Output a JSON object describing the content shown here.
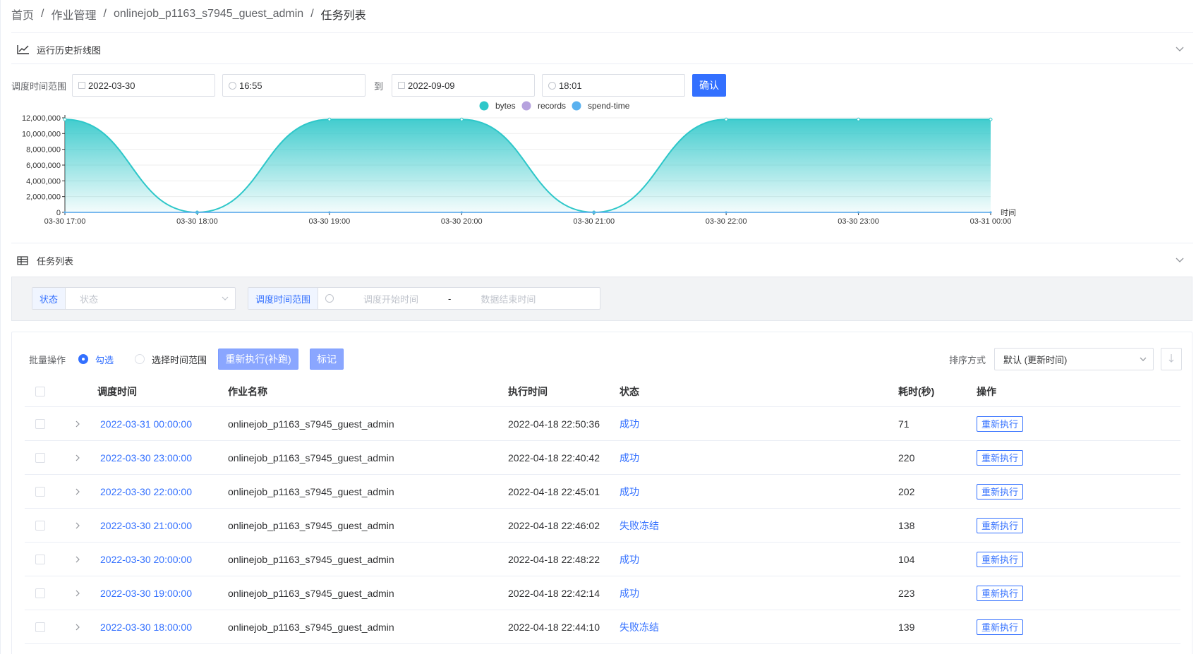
{
  "breadcrumb": [
    "首页",
    "作业管理",
    "onlinejob_p1163_s7945_guest_admin",
    "任务列表"
  ],
  "history_section": {
    "title": "运行历史折线图",
    "icon": "line-chart-icon",
    "collapse_icon": "chevron-down-icon"
  },
  "date_range": {
    "label": "调度时间范围",
    "start_date": "2022-03-30",
    "start_time": "16:55",
    "to_label": "到",
    "end_date": "2022-09-09",
    "end_time": "18:01",
    "confirm_label": "确认"
  },
  "chart_data": {
    "type": "area",
    "legend": [
      "bytes",
      "records",
      "spend-time"
    ],
    "legend_position": "top-center",
    "colors": {
      "bytes": "#2ec7c9",
      "records": "#b6a2de",
      "spend-time": "#5ab1ef"
    },
    "x": [
      "03-30 17:00",
      "03-30 18:00",
      "03-30 19:00",
      "03-30 20:00",
      "03-30 21:00",
      "03-30 22:00",
      "03-30 23:00",
      "03-31 00:00"
    ],
    "xlabel": "时间",
    "ylim": [
      0,
      12000000
    ],
    "yticks": [
      "0",
      "2,000,000",
      "4,000,000",
      "6,000,000",
      "8,000,000",
      "10,000,000",
      "12,000,000"
    ],
    "series": [
      {
        "name": "bytes",
        "values": [
          11800000,
          0,
          11800000,
          11800000,
          0,
          11800000,
          11800000,
          11800000
        ]
      },
      {
        "name": "records",
        "values": [
          0,
          0,
          0,
          0,
          0,
          0,
          0,
          0
        ]
      },
      {
        "name": "spend-time",
        "values": [
          0,
          0,
          0,
          0,
          0,
          0,
          0,
          0
        ]
      }
    ],
    "grid": true
  },
  "task_section": {
    "title": "任务列表",
    "icon": "table-icon",
    "collapse_icon": "chevron-down-icon"
  },
  "filters": {
    "status_label": "状态",
    "status_placeholder": "状态",
    "range_label": "调度时间范围",
    "start_placeholder": "调度开始时间",
    "dash": "-",
    "end_placeholder": "数据结束时间"
  },
  "batch": {
    "label": "批量操作",
    "option_check": "勾选",
    "option_range": "选择时间范围",
    "rerun_label": "重新执行(补跑)",
    "mark_label": "标记"
  },
  "sort": {
    "label": "排序方式",
    "value": "默认 (更新时间)"
  },
  "table": {
    "headers": {
      "schedule_time": "调度时间",
      "job_name": "作业名称",
      "exec_time": "执行时间",
      "status": "状态",
      "duration": "耗时(秒)",
      "action": "操作"
    },
    "rows": [
      {
        "schedule_time": "2022-03-31 00:00:00",
        "job_name": "onlinejob_p1163_s7945_guest_admin",
        "exec_time": "2022-04-18 22:50:36",
        "status": "成功",
        "duration": "71",
        "action": "重新执行"
      },
      {
        "schedule_time": "2022-03-30 23:00:00",
        "job_name": "onlinejob_p1163_s7945_guest_admin",
        "exec_time": "2022-04-18 22:40:42",
        "status": "成功",
        "duration": "220",
        "action": "重新执行"
      },
      {
        "schedule_time": "2022-03-30 22:00:00",
        "job_name": "onlinejob_p1163_s7945_guest_admin",
        "exec_time": "2022-04-18 22:45:01",
        "status": "成功",
        "duration": "202",
        "action": "重新执行"
      },
      {
        "schedule_time": "2022-03-30 21:00:00",
        "job_name": "onlinejob_p1163_s7945_guest_admin",
        "exec_time": "2022-04-18 22:46:02",
        "status": "失败冻结",
        "duration": "138",
        "action": "重新执行"
      },
      {
        "schedule_time": "2022-03-30 20:00:00",
        "job_name": "onlinejob_p1163_s7945_guest_admin",
        "exec_time": "2022-04-18 22:48:22",
        "status": "成功",
        "duration": "104",
        "action": "重新执行"
      },
      {
        "schedule_time": "2022-03-30 19:00:00",
        "job_name": "onlinejob_p1163_s7945_guest_admin",
        "exec_time": "2022-04-18 22:42:14",
        "status": "成功",
        "duration": "223",
        "action": "重新执行"
      },
      {
        "schedule_time": "2022-03-30 18:00:00",
        "job_name": "onlinejob_p1163_s7945_guest_admin",
        "exec_time": "2022-04-18 22:44:10",
        "status": "失败冻结",
        "duration": "139",
        "action": "重新执行"
      }
    ]
  }
}
